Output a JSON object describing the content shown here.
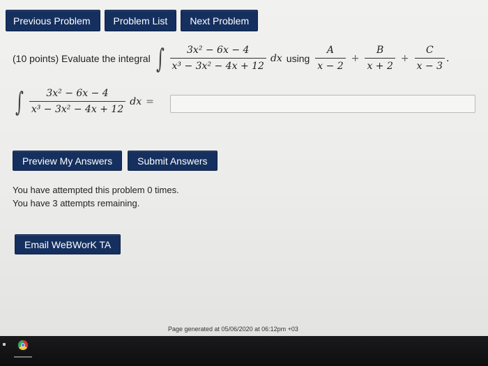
{
  "nav": {
    "previous": "Previous Problem",
    "list": "Problem List",
    "next": "Next Problem"
  },
  "problem": {
    "points": "(10 points) Evaluate the integral",
    "integrand_num": "3x² − 6x − 4",
    "integrand_den": "x³ − 3x² − 4x + 12",
    "dx": "dx",
    "using": "using",
    "termA_num": "A",
    "termA_den": "x − 2",
    "termB_num": "B",
    "termB_den": "x + 2",
    "termC_num": "C",
    "termC_den": "x − 3",
    "plus": "+",
    "period": ".",
    "equals": "="
  },
  "answer": {
    "value": "",
    "placeholder": ""
  },
  "actions": {
    "preview": "Preview My Answers",
    "submit": "Submit Answers"
  },
  "status": {
    "attempted": "You have attempted this problem 0 times.",
    "remaining": "You have 3 attempts remaining."
  },
  "email_label": "Email WeBWorK TA",
  "footer": "Page generated at 05/06/2020 at 06:12pm +03",
  "colors": {
    "button_bg": "#15305f",
    "button_text": "#ffffff"
  },
  "icons": {
    "integral": "integral-sign-icon",
    "browser": "chrome-icon"
  }
}
